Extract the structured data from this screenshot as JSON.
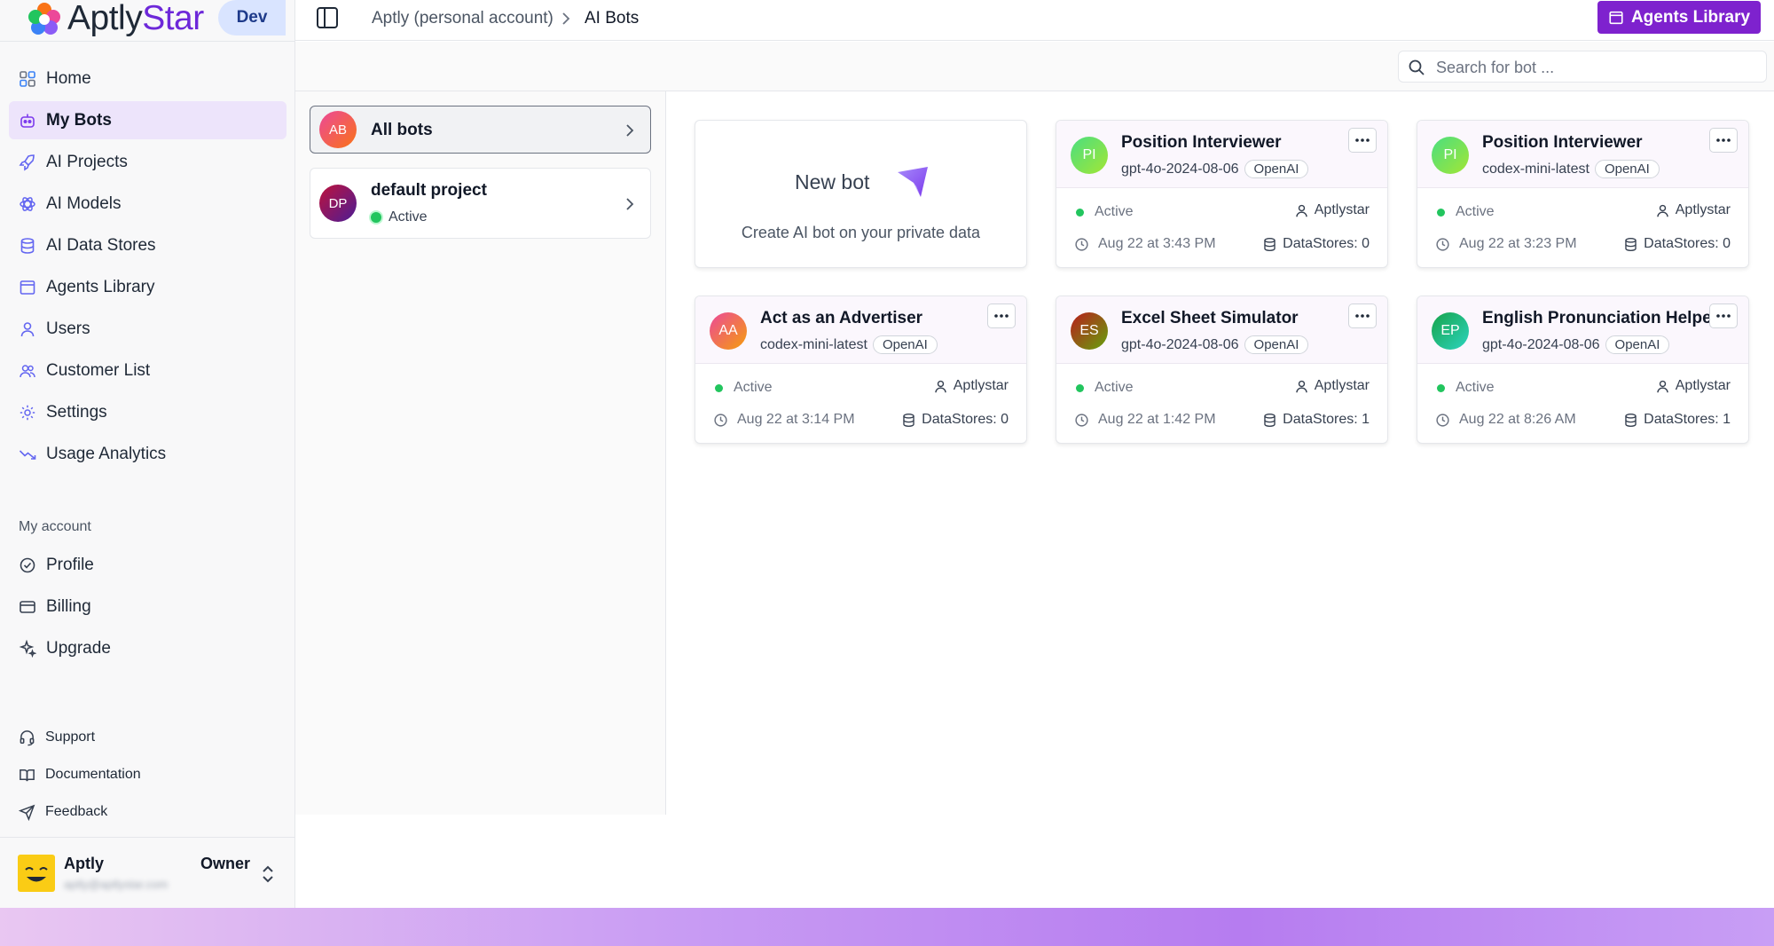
{
  "brand": {
    "name_a": "Aptly",
    "name_b": "Star",
    "env": "Dev"
  },
  "sidebar": {
    "items": [
      {
        "label": "Home",
        "icon": "home-grid-icon"
      },
      {
        "label": "My Bots",
        "icon": "bot-icon",
        "active": true
      },
      {
        "label": "AI Projects",
        "icon": "rocket-icon"
      },
      {
        "label": "AI Models",
        "icon": "atom-icon"
      },
      {
        "label": "AI Data Stores",
        "icon": "database-icon"
      },
      {
        "label": "Agents Library",
        "icon": "library-icon"
      },
      {
        "label": "Users",
        "icon": "user-icon"
      },
      {
        "label": "Customer List",
        "icon": "users-icon"
      },
      {
        "label": "Settings",
        "icon": "gear-icon"
      },
      {
        "label": "Usage Analytics",
        "icon": "trend-icon"
      }
    ],
    "account_label": "My account",
    "account_items": [
      {
        "label": "Profile",
        "icon": "badge-check-icon"
      },
      {
        "label": "Billing",
        "icon": "credit-card-icon"
      },
      {
        "label": "Upgrade",
        "icon": "sparkles-icon"
      }
    ],
    "bottom_items": [
      {
        "label": "Support",
        "icon": "headset-icon"
      },
      {
        "label": "Documentation",
        "icon": "book-icon"
      },
      {
        "label": "Feedback",
        "icon": "send-icon"
      }
    ],
    "user": {
      "name": "Aptly",
      "role": "Owner",
      "email": "aptly@aptlystar.com"
    }
  },
  "topbar": {
    "breadcrumb_account": "Aptly (personal account)",
    "breadcrumb_current": "AI Bots",
    "agents_button": "Agents Library"
  },
  "search": {
    "placeholder": "Search for bot ..."
  },
  "projects": [
    {
      "initials": "AB",
      "name": "All bots",
      "selected": true
    },
    {
      "initials": "DP",
      "name": "default project",
      "status": "Active"
    }
  ],
  "new_bot": {
    "title": "New bot",
    "subtitle": "Create AI bot on your private data"
  },
  "bots": [
    {
      "initials": "PI",
      "name": "Position Interviewer",
      "model": "gpt-4o-2024-08-06",
      "provider": "OpenAI",
      "status": "Active",
      "owner": "Aptlystar",
      "date": "Aug 22 at 3:43 PM",
      "datastores": "DataStores: 0"
    },
    {
      "initials": "PI",
      "name": "Position Interviewer",
      "model": "codex-mini-latest",
      "provider": "OpenAI",
      "status": "Active",
      "owner": "Aptlystar",
      "date": "Aug 22 at 3:23 PM",
      "datastores": "DataStores: 0"
    },
    {
      "initials": "AA",
      "name": "Act as an Advertiser",
      "model": "codex-mini-latest",
      "provider": "OpenAI",
      "status": "Active",
      "owner": "Aptlystar",
      "date": "Aug 22 at 3:14 PM",
      "datastores": "DataStores: 0"
    },
    {
      "initials": "ES",
      "name": "Excel Sheet Simulator",
      "model": "gpt-4o-2024-08-06",
      "provider": "OpenAI",
      "status": "Active",
      "owner": "Aptlystar",
      "date": "Aug 22 at 1:42 PM",
      "datastores": "DataStores: 1"
    },
    {
      "initials": "EP",
      "name": "English Pronunciation Helper",
      "model": "gpt-4o-2024-08-06",
      "provider": "OpenAI",
      "status": "Active",
      "owner": "Aptlystar",
      "date": "Aug 22 at 8:26 AM",
      "datastores": "DataStores: 1"
    }
  ],
  "colors": {
    "accent": "#7e22ce",
    "active_nav": "#ede4fb",
    "status_green": "#22c55e"
  }
}
